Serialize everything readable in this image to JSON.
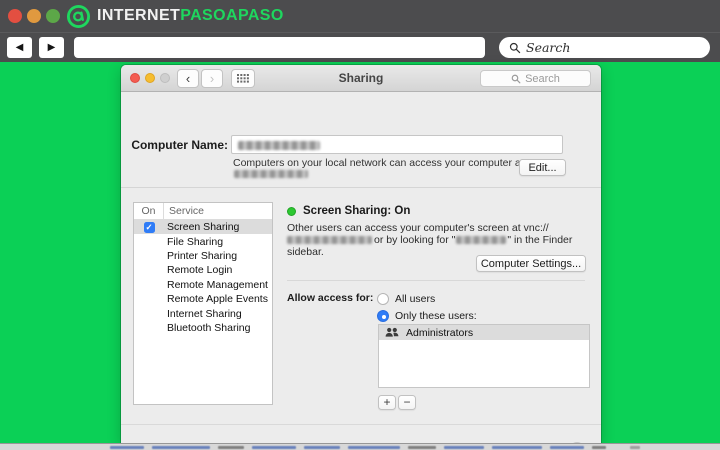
{
  "colors": {
    "page_green": "#0bd056",
    "chrome_gray": "#4c4c4e",
    "brand_green": "#1ed75e",
    "accent_blue": "#2f7cf7",
    "status_green": "#2cc831",
    "selection_gray": "#dcdcdc"
  },
  "browser": {
    "brand_word_white": "INTERNET",
    "brand_green_parts": [
      "PASO",
      "A",
      "PASO"
    ],
    "search_placeholder": "Search"
  },
  "icons": {
    "browser_back": "◀",
    "browser_forward": "▶",
    "window_back": "‹",
    "window_forward": "›",
    "checkbox_check": "✓",
    "help": "?"
  },
  "window": {
    "title": "Sharing",
    "toolbar_search_placeholder": "Search",
    "computer_name": {
      "label": "Computer Name:",
      "info": "Computers on your local network can access your computer at:",
      "edit_button": "Edit..."
    },
    "services": {
      "col_on": "On",
      "col_service": "Service",
      "items": [
        {
          "label": "Screen Sharing",
          "checked": true,
          "selected": true
        },
        {
          "label": "File Sharing"
        },
        {
          "label": "Printer Sharing"
        },
        {
          "label": "Remote Login"
        },
        {
          "label": "Remote Management"
        },
        {
          "label": "Remote Apple Events"
        },
        {
          "label": "Internet Sharing"
        },
        {
          "label": "Bluetooth Sharing"
        }
      ]
    },
    "detail": {
      "status": "Screen Sharing: On",
      "desc_line1": "Other users can access your computer's screen at vnc://",
      "desc_line2_mid": "or by looking for \"",
      "desc_line2_end": "\" in the Finder",
      "desc_line3": "sidebar.",
      "settings_button": "Computer Settings...",
      "allow_label": "Allow access for:",
      "radio_all": "All users",
      "radio_only": "Only these users:",
      "user_group": "Administrators",
      "add_label": "+",
      "remove_label": "−"
    }
  }
}
